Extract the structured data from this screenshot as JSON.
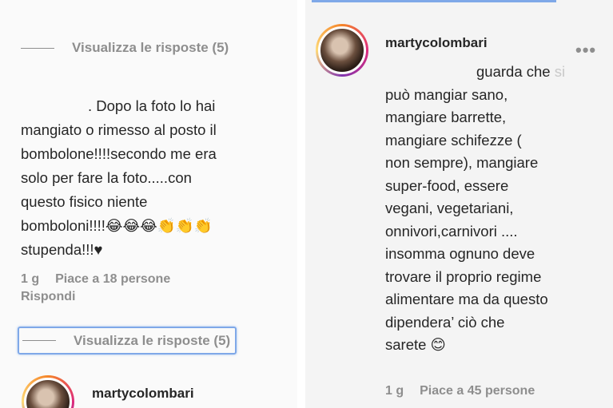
{
  "left": {
    "view_replies_top": "Visualizza le risposte (5)",
    "comment_lines": [
      ". Dopo la foto lo hai",
      "mangiato o rimesso al posto il",
      "bombolone!!!!secondo me era",
      "solo per fare la foto.....con",
      "questo fisico niente",
      "bomboloni!!!!😂😂😂👏👏👏",
      "stupenda!!!♥"
    ],
    "meta_time": "1 g",
    "meta_likes": "Piace a 18 persone",
    "reply_label": "Rispondi",
    "view_replies_bottom": "Visualizza le risposte (5)",
    "next_username": "martycolombari"
  },
  "right": {
    "username": "martycolombari",
    "more_icon": "more-options-icon",
    "first_line": "guarda che",
    "first_line_faded": " si",
    "comment_lines": [
      "può mangiar sano,",
      "mangiare barrette,",
      "mangiare schifezze (",
      "non sempre), mangiare",
      "super-food, essere",
      "vegani, vegetariani,",
      "onnivori,carnivori ....",
      "insomma ognuno deve",
      "trovare il proprio regime",
      "alimentare ma da questo",
      "dipendera’ ciò che",
      "sarete 😊"
    ],
    "meta_time": "1 g",
    "meta_likes": "Piace a 45 persone"
  },
  "colors": {
    "text": "#262626",
    "muted": "#8e8e8e",
    "focus_outline": "#7fa8e8"
  }
}
